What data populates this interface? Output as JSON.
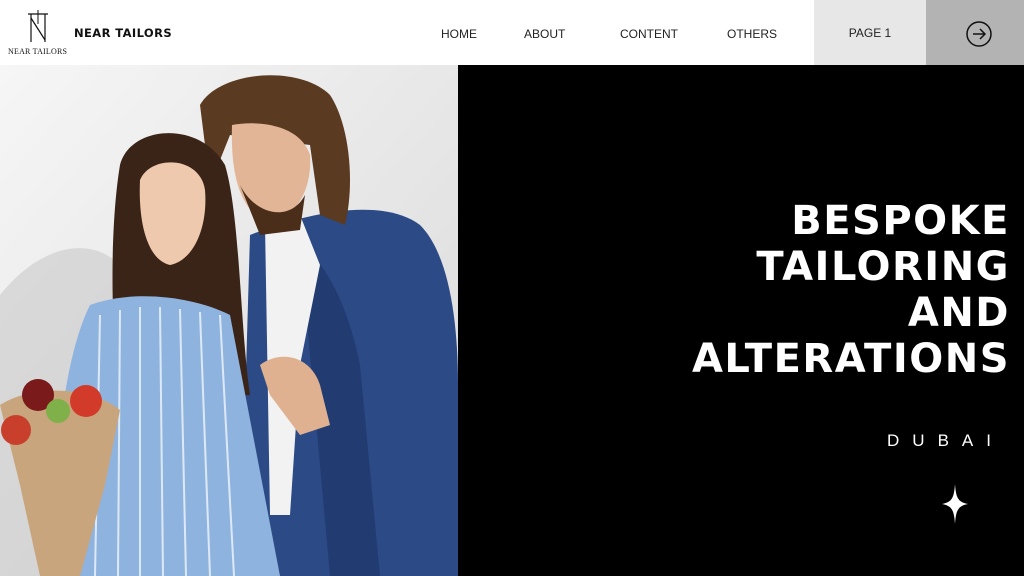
{
  "header": {
    "logo_monogram": "N",
    "logo_text": "NEAR TAILORS",
    "brand_name": "NEAR TAILORS"
  },
  "nav": {
    "items": [
      {
        "label": "HOME"
      },
      {
        "label": "ABOUT"
      },
      {
        "label": "CONTENT"
      },
      {
        "label": "OTHERS"
      }
    ],
    "page_label": "PAGE 1",
    "next_icon": "arrow-right-circle-icon"
  },
  "hero": {
    "title_lines": [
      "BESPOKE",
      "TAILORING",
      "AND",
      "ALTERATIONS"
    ],
    "city": "DUBAI",
    "decor_icon": "sparkle-icon"
  },
  "colors": {
    "header_bg": "#ffffff",
    "page_button_bg": "#e7e7e7",
    "next_button_bg": "#b3b3b3",
    "hero_bg": "#000000",
    "hero_text": "#ffffff"
  }
}
